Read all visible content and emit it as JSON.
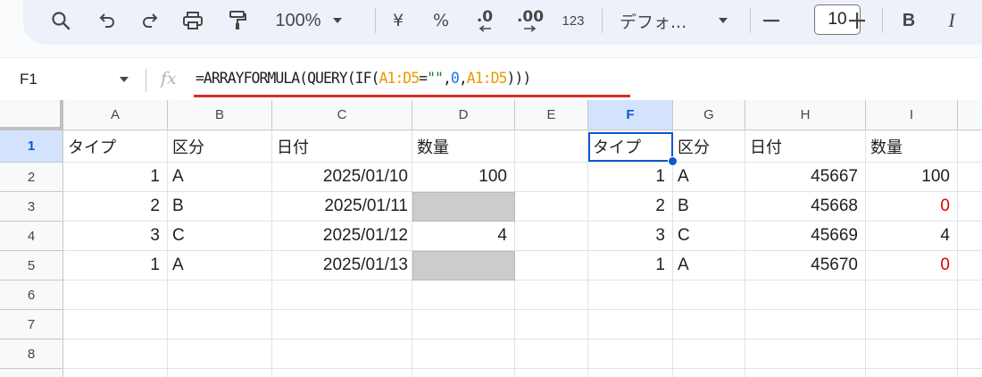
{
  "toolbar": {
    "zoom": "100%",
    "currency": "¥",
    "percent": "%",
    "decrease_decimals": ".0",
    "increase_decimals": ".00",
    "number_format": "123",
    "font": "デフォ...",
    "font_size": "10",
    "bold": "B",
    "italic": "I"
  },
  "formula_bar": {
    "cell_ref": "F1",
    "fx_label": "fx",
    "formula_parts": {
      "p1": "=ARRAYFORMULA(QUERY(IF(",
      "ref1": "A1:D5",
      "p2": "=",
      "str": "\"\"",
      "p3": ",",
      "num": "0",
      "p4": ",",
      "ref2": "A1:D5",
      "p5": ")))"
    }
  },
  "columns": [
    "A",
    "B",
    "C",
    "D",
    "E",
    "F",
    "G",
    "H",
    "I"
  ],
  "selected_column": "F",
  "rows": [
    "1",
    "2",
    "3",
    "4",
    "5",
    "6",
    "7",
    "8"
  ],
  "selected_row": "1",
  "sheet": {
    "headers": [
      "タイプ",
      "区分",
      "日付",
      "数量"
    ],
    "source_rows": [
      {
        "type": "1",
        "kubun": "A",
        "date": "2025/01/10",
        "qty": "100"
      },
      {
        "type": "2",
        "kubun": "B",
        "date": "2025/01/11",
        "qty": ""
      },
      {
        "type": "3",
        "kubun": "C",
        "date": "2025/01/12",
        "qty": "4"
      },
      {
        "type": "1",
        "kubun": "A",
        "date": "2025/01/13",
        "qty": ""
      }
    ],
    "result_headers": [
      "タイプ",
      "区分",
      "日付",
      "数量"
    ],
    "result_rows": [
      {
        "type": "1",
        "kubun": "A",
        "date": "45667",
        "qty": "100"
      },
      {
        "type": "2",
        "kubun": "B",
        "date": "45668",
        "qty": "0"
      },
      {
        "type": "3",
        "kubun": "C",
        "date": "45669",
        "qty": "4"
      },
      {
        "type": "1",
        "kubun": "A",
        "date": "45670",
        "qty": "0"
      }
    ]
  },
  "colors": {
    "selection": "#0b57d0",
    "empty_cell_fill": "#cccccc",
    "zero_text": "#e00000",
    "range_ref": "#e69b00",
    "underline": "#d93025"
  }
}
